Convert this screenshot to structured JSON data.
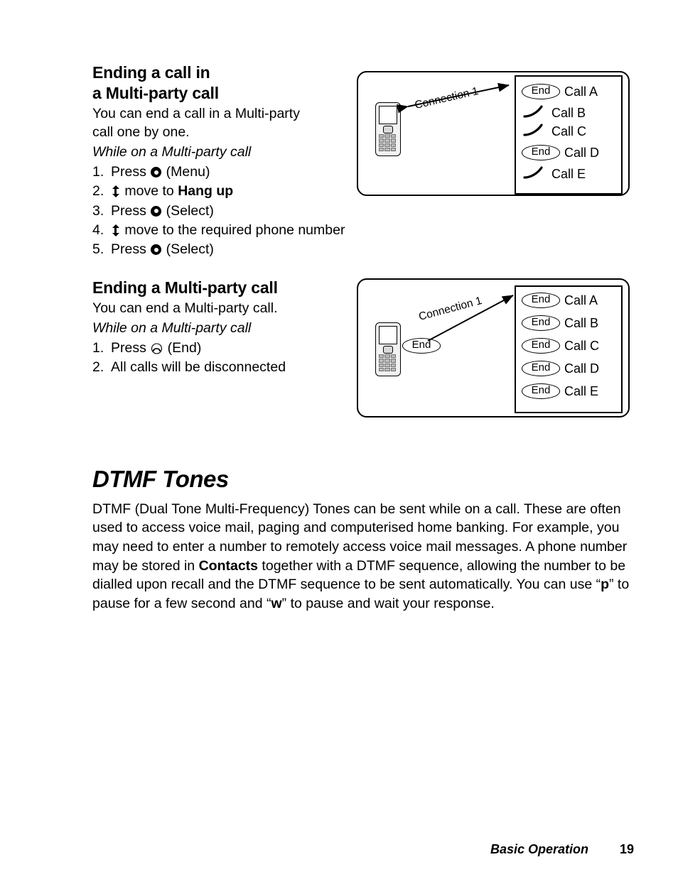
{
  "document": {
    "page_number": "19",
    "footer_section": "Basic Operation"
  },
  "section1": {
    "heading_line1": "Ending a call in",
    "heading_line2": "a Multi-party call",
    "intro_line1": "You can end a call in a Multi-party",
    "intro_line2": "call one by one.",
    "condition": "While on a Multi-party call",
    "steps": [
      {
        "num": "1.",
        "pre": "Press ",
        "post": " (Menu)"
      },
      {
        "num": "2.",
        "pre": " move to ",
        "bold": "Hang up",
        "post": ""
      },
      {
        "num": "3.",
        "pre": "Press ",
        "post": " (Select)"
      },
      {
        "num": "4.",
        "pre": " move to the required phone number",
        "post": ""
      },
      {
        "num": "5.",
        "pre": "Press ",
        "post": " (Select)"
      }
    ]
  },
  "section2": {
    "heading": "Ending a Multi-party call",
    "intro": "You can end a Multi-party call.",
    "condition": "While on a Multi-party call",
    "steps": [
      {
        "num": "1.",
        "pre": "Press ",
        "post": " (End)"
      },
      {
        "num": "2.",
        "pre": "All calls will be disconnected",
        "post": ""
      }
    ]
  },
  "figure1": {
    "connection_label": "Connection 1",
    "rows": [
      {
        "badge": "End",
        "label": "Call A",
        "type": "end"
      },
      {
        "badge": "",
        "label": "Call B",
        "type": "curve"
      },
      {
        "badge": "",
        "label": "Call C",
        "type": "curve"
      },
      {
        "badge": "End",
        "label": "Call D",
        "type": "end"
      },
      {
        "badge": "",
        "label": "Call E",
        "type": "curve"
      }
    ]
  },
  "figure2": {
    "connection_label": "Connection 1",
    "phone_badge": "End",
    "rows": [
      {
        "badge": "End",
        "label": "Call A"
      },
      {
        "badge": "End",
        "label": "Call B"
      },
      {
        "badge": "End",
        "label": "Call C"
      },
      {
        "badge": "End",
        "label": "Call D"
      },
      {
        "badge": "End",
        "label": "Call E"
      }
    ]
  },
  "dtmf": {
    "title": "DTMF Tones",
    "paragraph_parts": {
      "p1": "DTMF (Dual Tone Multi-Frequency) Tones can be sent while on a call. These are often used to access voice mail, paging and computerised home banking. For example, you may need to enter a number to remotely access voice mail messages. A phone number may be stored in ",
      "bold1": "Contacts",
      "p2": " together with a DTMF sequence, allowing the number to be dialled upon recall and the DTMF sequence to be sent automatically. You can use “",
      "bold2": "p",
      "p3": "” to pause for a few second and “",
      "bold3": "w",
      "p4": "” to pause and wait your response."
    }
  }
}
